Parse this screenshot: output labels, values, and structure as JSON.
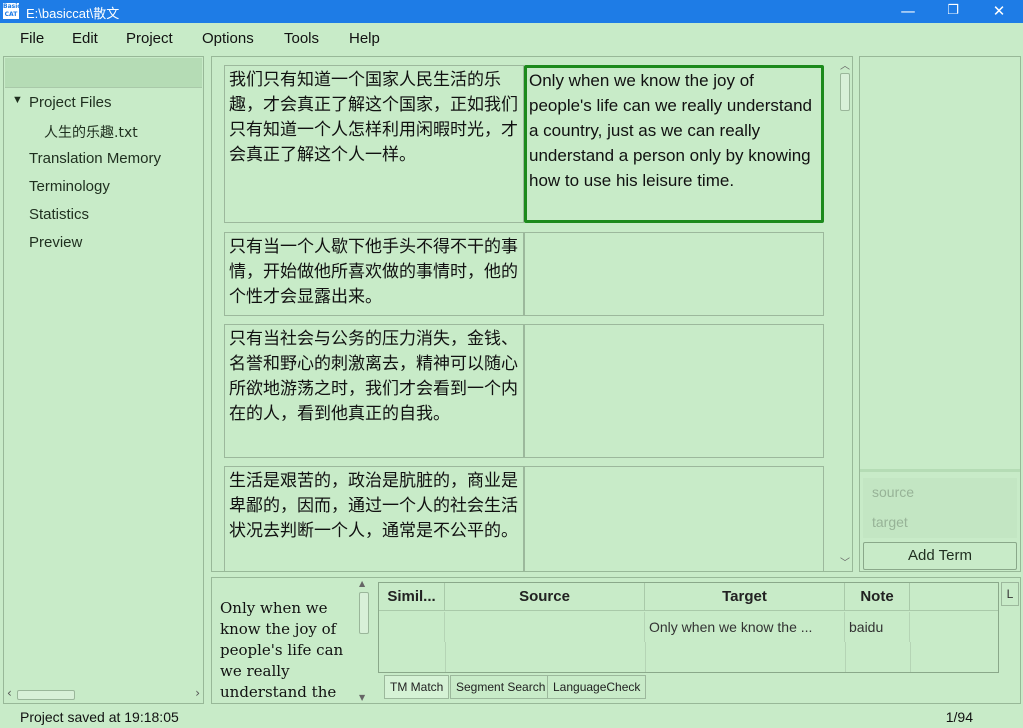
{
  "window": {
    "title": "E:\\basiccat\\散文",
    "app_icon_text": "Basic\nCAT",
    "minimize": "—",
    "maximize": "❐",
    "close": "✕"
  },
  "menu": [
    "File",
    "Edit",
    "Project",
    "Options",
    "Tools",
    "Help"
  ],
  "sidebar": {
    "project_files": "Project Files",
    "file": "人生的乐趣.txt",
    "items": [
      "Translation Memory",
      "Terminology",
      "Statistics",
      "Preview"
    ]
  },
  "segments": [
    {
      "source": "我们只有知道一个国家人民生活的乐趣，才会真正了解这个国家，正如我们只有知道一个人怎样利用闲暇时光，才会真正了解这个人一样。",
      "target": "Only when we know the joy of people's life can we really understand a country, just as we can really understand a person only by knowing how to use his leisure time."
    },
    {
      "source": "只有当一个人歇下他手头不得不干的事情，开始做他所喜欢做的事情时，他的个性才会显露出来。",
      "target": ""
    },
    {
      "source": "只有当社会与公务的压力消失，金钱、名誉和野心的刺激离去，精神可以随心所欲地游荡之时，我们才会看到一个内在的人，看到他真正的自我。",
      "target": ""
    },
    {
      "source": "生活是艰苦的，政治是肮脏的，商业是卑鄙的，因而，通过一个人的社会生活状况去判断一个人，通常是不公平的。",
      "target": ""
    }
  ],
  "terms": {
    "source_placeholder": "source",
    "target_placeholder": "target",
    "add_term": "Add Term"
  },
  "preview_text": "Only when we know the joy of people's life can we really understand the country, just as",
  "match_table": {
    "headers": [
      "Simil...",
      "Source",
      "Target",
      "Note"
    ],
    "rows": [
      {
        "similarity": "",
        "source": "",
        "target": "Only when we know the ...",
        "note": "baidu"
      }
    ]
  },
  "tabs": [
    "TM Match",
    "Segment Search",
    "LanguageCheck"
  ],
  "side_tab": "L",
  "status": {
    "left": "Project saved at 19:18:05",
    "right": "1/94"
  }
}
